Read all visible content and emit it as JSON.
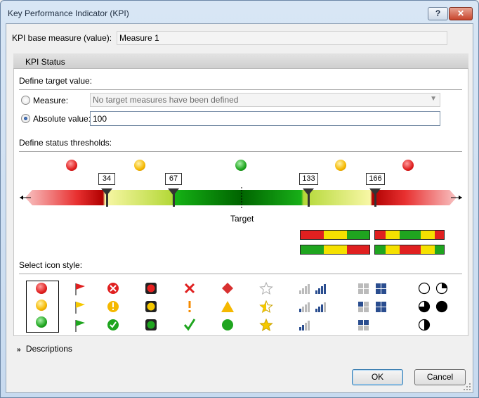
{
  "window": {
    "title": "Key Performance Indicator (KPI)",
    "help": "?",
    "close": "✕"
  },
  "base_measure": {
    "label": "KPI base measure (value):",
    "value": "Measure 1"
  },
  "tab": {
    "label": "KPI Status"
  },
  "target": {
    "section_title": "Define target value:",
    "measure_label": "Measure:",
    "measure_placeholder": "No target measures have been defined",
    "absolute_label": "Absolute value:",
    "absolute_value": "100",
    "selected": "absolute"
  },
  "thresholds": {
    "section_title": "Define status thresholds:",
    "values": [
      "34",
      "67",
      "133",
      "166"
    ],
    "target_label": "Target",
    "status_colors": [
      "#e02020",
      "#f5b800",
      "#1fa51f",
      "#f5b800",
      "#e02020"
    ]
  },
  "icon_style": {
    "section_title": "Select icon style:",
    "sets": [
      "circle-icons",
      "flag-icons",
      "symbol-circle-icons",
      "traffic-light-icons",
      "mark-icons",
      "shape-icons",
      "star-icons",
      "signal-bars-icons",
      "quadrant-icons",
      "pie-icons"
    ]
  },
  "descriptions": {
    "label": "Descriptions"
  },
  "buttons": {
    "ok": "OK",
    "cancel": "Cancel"
  }
}
